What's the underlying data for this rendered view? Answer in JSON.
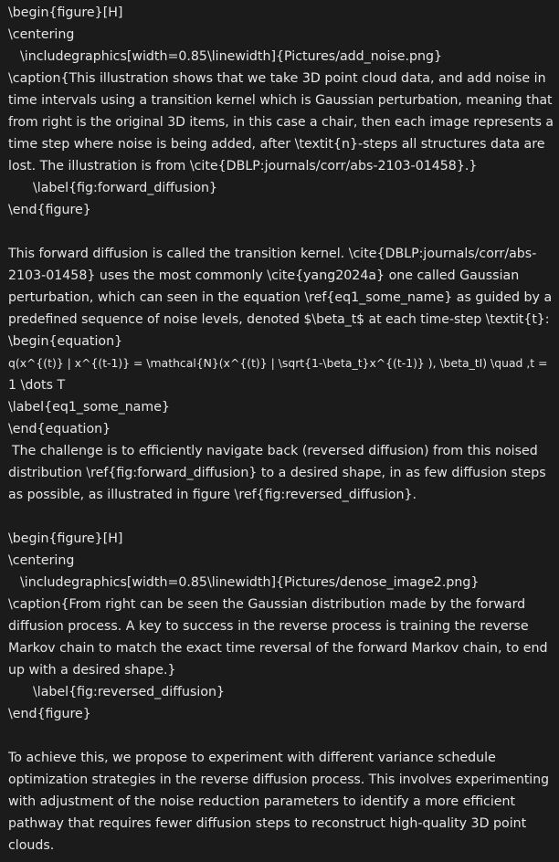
{
  "block1": {
    "l1": "\\begin{figure}[H]",
    "l2": "\\centering",
    "l3": "\\includegraphics[width=0.85\\linewidth]{Pictures/add_noise.png}",
    "l4": "\\caption{This illustration shows that we take 3D point cloud data, and add noise in",
    "l5": "time intervals using a transition kernel which is Gaussian perturbation, meaning that",
    "l6": "from right is the original 3D items, in this case a chair, then each image represents a",
    "l7": "time step where noise is being added, after \\textit{n}-steps all structures data are",
    "l8": "lost. The illustration is from \\cite{DBLP:journals/corr/abs-2103-01458}.}",
    "l9": "\\label{fig:forward_diffusion}",
    "l10": "\\end{figure}"
  },
  "block2": {
    "l1": "This forward diffusion is called the transition kernel. \\cite{DBLP:journals/corr/abs-",
    "l2": "2103-01458} uses the most commonly \\cite{yang2024a} one called Gaussian",
    "l3": "perturbation, which can seen in the equation \\ref{eq1_some_name} as guided by a",
    "l4": "predefined sequence of noise levels, denoted $\\beta_t$ at each time-step \\textit{t}:",
    "l5": "\\begin{equation}",
    "l6": "q(x^{(t)} | x^{(t-1)} = \\mathcal{N}(x^{(t)} | \\sqrt{1-\\beta_t}x^{(t-1)} ), \\beta_tI) \\quad ,t =",
    "l7": "1 \\dots T",
    "l8": "\\label{eq1_some_name}",
    "l9": "\\end{equation}",
    "l10": "The challenge is to efficiently navigate back (reversed diffusion) from this noised",
    "l11": "distribution \\ref{fig:forward_diffusion} to a desired shape, in as few diffusion steps",
    "l12": "as possible, as illustrated in figure \\ref{fig:reversed_diffusion}."
  },
  "block3": {
    "l1": "\\begin{figure}[H]",
    "l2": "\\centering",
    "l3": "\\includegraphics[width=0.85\\linewidth]{Pictures/denose_image2.png}",
    "l4": "\\caption{From right can be seen the Gaussian distribution made by the forward",
    "l5": "diffusion process. A key to success in the reverse process is training the reverse",
    "l6": "Markov chain to match the exact time reversal of the forward Markov chain, to end",
    "l7": "up with a desired shape.}",
    "l8": "\\label{fig:reversed_diffusion}",
    "l9": "\\end{figure}"
  },
  "block4": {
    "l1": "To achieve this, we propose to experiment with different variance schedule",
    "l2": "optimization strategies in the reverse diffusion process. This involves experimenting",
    "l3": "with adjustment of the noise reduction parameters to identify a more efficient",
    "l4": "pathway that requires fewer diffusion steps to reconstruct high-quality 3D point",
    "l5": "clouds."
  }
}
